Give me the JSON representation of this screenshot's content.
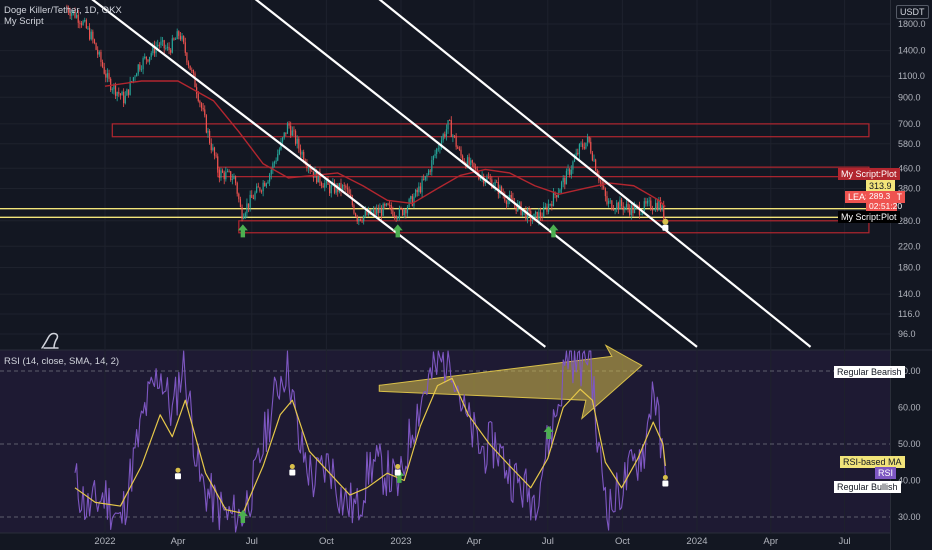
{
  "header": {
    "symbol": "Doge Killer/Tether, 1D, OKX",
    "indicator": "My Script",
    "currency": "USDT"
  },
  "rsi_header": "RSI (14, close, SMA, 14, 2)",
  "price_labels": {
    "myscript_plot_top": "My Script:Plot",
    "upper_value": "313.9",
    "last_symbol": "LEASHUSDT",
    "last_price": "289.3",
    "countdown": "02:51:20",
    "myscript_plot_bottom": "My Script:Plot"
  },
  "rsi_labels": {
    "regular_bearish": "Regular Bearish",
    "rsi_ma": "RSI-based MA",
    "rsi": "RSI",
    "regular_bullish": "Regular Bullish"
  },
  "colors": {
    "background": "#131722",
    "rsi_band": "#1e1a33",
    "candle_up": "#26a69a",
    "candle_down": "#ef5350",
    "ma_line": "#b2262f",
    "zone": "#b2262f",
    "level_line": "#f2e47a",
    "trendline": "#ffffff",
    "rsi_line": "#7e57c2",
    "rsi_ma_line": "#e6c84a",
    "arrow_green": "#4caf50",
    "arrow_yellow": "#d9c04a"
  },
  "chart_data": [
    {
      "type": "candlestick",
      "title": "Doge Killer/Tether, 1D, OKX",
      "scale": "log",
      "y_ticks": [
        1800,
        1400,
        1100,
        900,
        700,
        580,
        460,
        380,
        280,
        220,
        180,
        140,
        116,
        96
      ],
      "y_tick_labels": [
        "1800.0",
        "1400.0",
        "1100.0",
        "900.0",
        "700.0",
        "580.0",
        "460.0",
        "380.0",
        "280.0",
        "220.0",
        "180.0",
        "140.0",
        "116.0",
        "96.0"
      ],
      "x_tick_labels": [
        "2022",
        "Apr",
        "Jul",
        "Oct",
        "2023",
        "Apr",
        "Jul",
        "Oct",
        "2024",
        "Apr",
        "Jul"
      ],
      "x_ticks": [
        "2022-01-01",
        "2022-04-01",
        "2022-07-01",
        "2022-10-01",
        "2023-01-01",
        "2023-04-01",
        "2023-07-01",
        "2023-10-01",
        "2024-01-01",
        "2024-04-01",
        "2024-07-01"
      ],
      "close_path": [
        [
          "2021-11-15",
          2100
        ],
        [
          "2021-12-01",
          1900
        ],
        [
          "2021-12-15",
          1600
        ],
        [
          "2022-01-05",
          1050
        ],
        [
          "2022-01-25",
          880
        ],
        [
          "2022-02-10",
          1200
        ],
        [
          "2022-02-25",
          1350
        ],
        [
          "2022-03-08",
          1500
        ],
        [
          "2022-03-20",
          1400
        ],
        [
          "2022-04-03",
          1650
        ],
        [
          "2022-04-25",
          950
        ],
        [
          "2022-05-10",
          600
        ],
        [
          "2022-05-22",
          440
        ],
        [
          "2022-06-10",
          420
        ],
        [
          "2022-06-18",
          300
        ],
        [
          "2022-07-05",
          360
        ],
        [
          "2022-07-22",
          430
        ],
        [
          "2022-08-05",
          560
        ],
        [
          "2022-08-15",
          700
        ],
        [
          "2022-08-28",
          560
        ],
        [
          "2022-09-15",
          440
        ],
        [
          "2022-10-05",
          380
        ],
        [
          "2022-10-25",
          380
        ],
        [
          "2022-11-08",
          290
        ],
        [
          "2022-11-28",
          300
        ],
        [
          "2022-12-15",
          315
        ],
        [
          "2022-12-30",
          300
        ],
        [
          "2023-01-15",
          340
        ],
        [
          "2023-02-01",
          420
        ],
        [
          "2023-02-15",
          560
        ],
        [
          "2023-03-01",
          700
        ],
        [
          "2023-03-15",
          520
        ],
        [
          "2023-04-05",
          440
        ],
        [
          "2023-04-25",
          400
        ],
        [
          "2023-05-10",
          350
        ],
        [
          "2023-05-25",
          320
        ],
        [
          "2023-06-12",
          285
        ],
        [
          "2023-06-25",
          300
        ],
        [
          "2023-07-08",
          350
        ],
        [
          "2023-07-25",
          430
        ],
        [
          "2023-08-10",
          560
        ],
        [
          "2023-08-20",
          600
        ],
        [
          "2023-08-30",
          460
        ],
        [
          "2023-09-12",
          330
        ],
        [
          "2023-09-28",
          325
        ],
        [
          "2023-10-15",
          310
        ],
        [
          "2023-10-30",
          320
        ],
        [
          "2023-11-15",
          330
        ],
        [
          "2023-11-23",
          289
        ]
      ],
      "moving_average": [
        [
          "2022-01-01",
          1000
        ],
        [
          "2022-02-15",
          1050
        ],
        [
          "2022-04-01",
          1050
        ],
        [
          "2022-05-15",
          870
        ],
        [
          "2022-06-15",
          650
        ],
        [
          "2022-07-15",
          480
        ],
        [
          "2022-08-15",
          420
        ],
        [
          "2022-09-15",
          430
        ],
        [
          "2022-10-15",
          440
        ],
        [
          "2022-11-15",
          390
        ],
        [
          "2022-12-15",
          340
        ],
        [
          "2023-01-15",
          330
        ],
        [
          "2023-02-15",
          380
        ],
        [
          "2023-03-15",
          430
        ],
        [
          "2023-04-15",
          455
        ],
        [
          "2023-05-15",
          440
        ],
        [
          "2023-06-15",
          390
        ],
        [
          "2023-07-15",
          360
        ],
        [
          "2023-08-15",
          380
        ],
        [
          "2023-09-15",
          400
        ],
        [
          "2023-10-15",
          390
        ],
        [
          "2023-11-15",
          340
        ],
        [
          "2023-11-23",
          320
        ]
      ],
      "zones": [
        {
          "low": 620,
          "high": 700,
          "start": "2022-01-10",
          "end": "2024-07-31"
        },
        {
          "low": 425,
          "high": 465,
          "start": "2022-05-20",
          "end": "2024-07-31"
        },
        {
          "low": 250,
          "high": 280,
          "start": "2022-06-15",
          "end": "2024-07-31"
        }
      ],
      "level_lines": [
        313.9,
        289.3
      ],
      "trendlines": [
        {
          "from": [
            "2021-11-30",
            2500
          ],
          "to": [
            "2023-06-28",
            85
          ]
        },
        {
          "from": [
            "2022-06-20",
            2500
          ],
          "to": [
            "2024-01-01",
            85
          ]
        },
        {
          "from": [
            "2022-11-20",
            2500
          ],
          "to": [
            "2024-05-20",
            85
          ]
        }
      ],
      "buy_arrows": [
        [
          "2022-06-20",
          268
        ],
        [
          "2022-12-28",
          268
        ],
        [
          "2023-07-08",
          268
        ]
      ],
      "last_marker": [
        "2023-11-23",
        275
      ]
    },
    {
      "type": "line",
      "title": "RSI (14, close, SMA, 14, 2)",
      "ylim": [
        28,
        77
      ],
      "y_ticks": [
        30,
        40,
        50,
        60,
        70
      ],
      "y_tick_labels": [
        "30.00",
        "40.00",
        "50.00",
        "60.00",
        "70.00"
      ],
      "dashed_levels": [
        70,
        50,
        30
      ],
      "series": [
        {
          "name": "RSI",
          "values": [
            [
              "2021-11-25",
              40
            ],
            [
              "2021-12-10",
              32
            ],
            [
              "2022-01-01",
              36
            ],
            [
              "2022-01-20",
              28
            ],
            [
              "2022-02-05",
              45
            ],
            [
              "2022-02-20",
              60
            ],
            [
              "2022-03-10",
              70
            ],
            [
              "2022-03-25",
              58
            ],
            [
              "2022-04-08",
              73
            ],
            [
              "2022-04-28",
              40
            ],
            [
              "2022-05-15",
              34
            ],
            [
              "2022-06-01",
              30
            ],
            [
              "2022-06-18",
              30
            ],
            [
              "2022-07-05",
              40
            ],
            [
              "2022-07-20",
              55
            ],
            [
              "2022-08-05",
              68
            ],
            [
              "2022-08-15",
              72
            ],
            [
              "2022-08-28",
              50
            ],
            [
              "2022-09-15",
              40
            ],
            [
              "2022-10-05",
              45
            ],
            [
              "2022-10-20",
              35
            ],
            [
              "2022-11-08",
              32
            ],
            [
              "2022-11-25",
              45
            ],
            [
              "2022-12-15",
              42
            ],
            [
              "2022-12-30",
              38
            ],
            [
              "2023-01-15",
              55
            ],
            [
              "2023-02-01",
              66
            ],
            [
              "2023-02-18",
              72
            ],
            [
              "2023-03-05",
              74
            ],
            [
              "2023-03-20",
              58
            ],
            [
              "2023-04-10",
              48
            ],
            [
              "2023-04-28",
              50
            ],
            [
              "2023-05-15",
              42
            ],
            [
              "2023-05-30",
              38
            ],
            [
              "2023-06-15",
              35
            ],
            [
              "2023-07-01",
              50
            ],
            [
              "2023-07-15",
              62
            ],
            [
              "2023-07-25",
              75
            ],
            [
              "2023-08-10",
              72
            ],
            [
              "2023-08-22",
              76
            ],
            [
              "2023-09-01",
              48
            ],
            [
              "2023-09-15",
              32
            ],
            [
              "2023-09-30",
              38
            ],
            [
              "2023-10-15",
              44
            ],
            [
              "2023-10-30",
              50
            ],
            [
              "2023-11-08",
              68
            ],
            [
              "2023-11-18",
              48
            ],
            [
              "2023-11-23",
              40
            ]
          ]
        },
        {
          "name": "RSI-based MA",
          "values": [
            [
              "2021-11-25",
              38
            ],
            [
              "2021-12-20",
              34
            ],
            [
              "2022-01-20",
              33
            ],
            [
              "2022-02-15",
              44
            ],
            [
              "2022-03-10",
              58
            ],
            [
              "2022-03-25",
              52
            ],
            [
              "2022-04-10",
              62
            ],
            [
              "2022-05-05",
              42
            ],
            [
              "2022-05-30",
              32
            ],
            [
              "2022-06-20",
              31
            ],
            [
              "2022-07-15",
              44
            ],
            [
              "2022-08-05",
              58
            ],
            [
              "2022-08-20",
              62
            ],
            [
              "2022-09-10",
              48
            ],
            [
              "2022-10-05",
              42
            ],
            [
              "2022-10-30",
              36
            ],
            [
              "2022-11-20",
              38
            ],
            [
              "2022-12-15",
              42
            ],
            [
              "2023-01-05",
              40
            ],
            [
              "2023-01-25",
              55
            ],
            [
              "2023-02-15",
              66
            ],
            [
              "2023-03-05",
              68
            ],
            [
              "2023-03-25",
              58
            ],
            [
              "2023-04-20",
              50
            ],
            [
              "2023-05-15",
              44
            ],
            [
              "2023-06-10",
              38
            ],
            [
              "2023-07-01",
              46
            ],
            [
              "2023-07-20",
              60
            ],
            [
              "2023-08-10",
              65
            ],
            [
              "2023-08-25",
              62
            ],
            [
              "2023-09-10",
              45
            ],
            [
              "2023-09-30",
              38
            ],
            [
              "2023-10-20",
              46
            ],
            [
              "2023-11-08",
              56
            ],
            [
              "2023-11-20",
              50
            ],
            [
              "2023-11-23",
              44
            ]
          ]
        }
      ],
      "divergence_arrow": {
        "from": [
          "2023-01-05",
          68
        ],
        "to": [
          "2023-10-25",
          72
        ],
        "label": "Regular Bearish"
      },
      "bullish_arrows": [
        [
          "2022-06-20",
          30
        ],
        [
          "2022-12-30",
          41
        ],
        [
          "2023-07-02",
          53
        ]
      ],
      "bullish_label": "Regular Bullish"
    }
  ]
}
